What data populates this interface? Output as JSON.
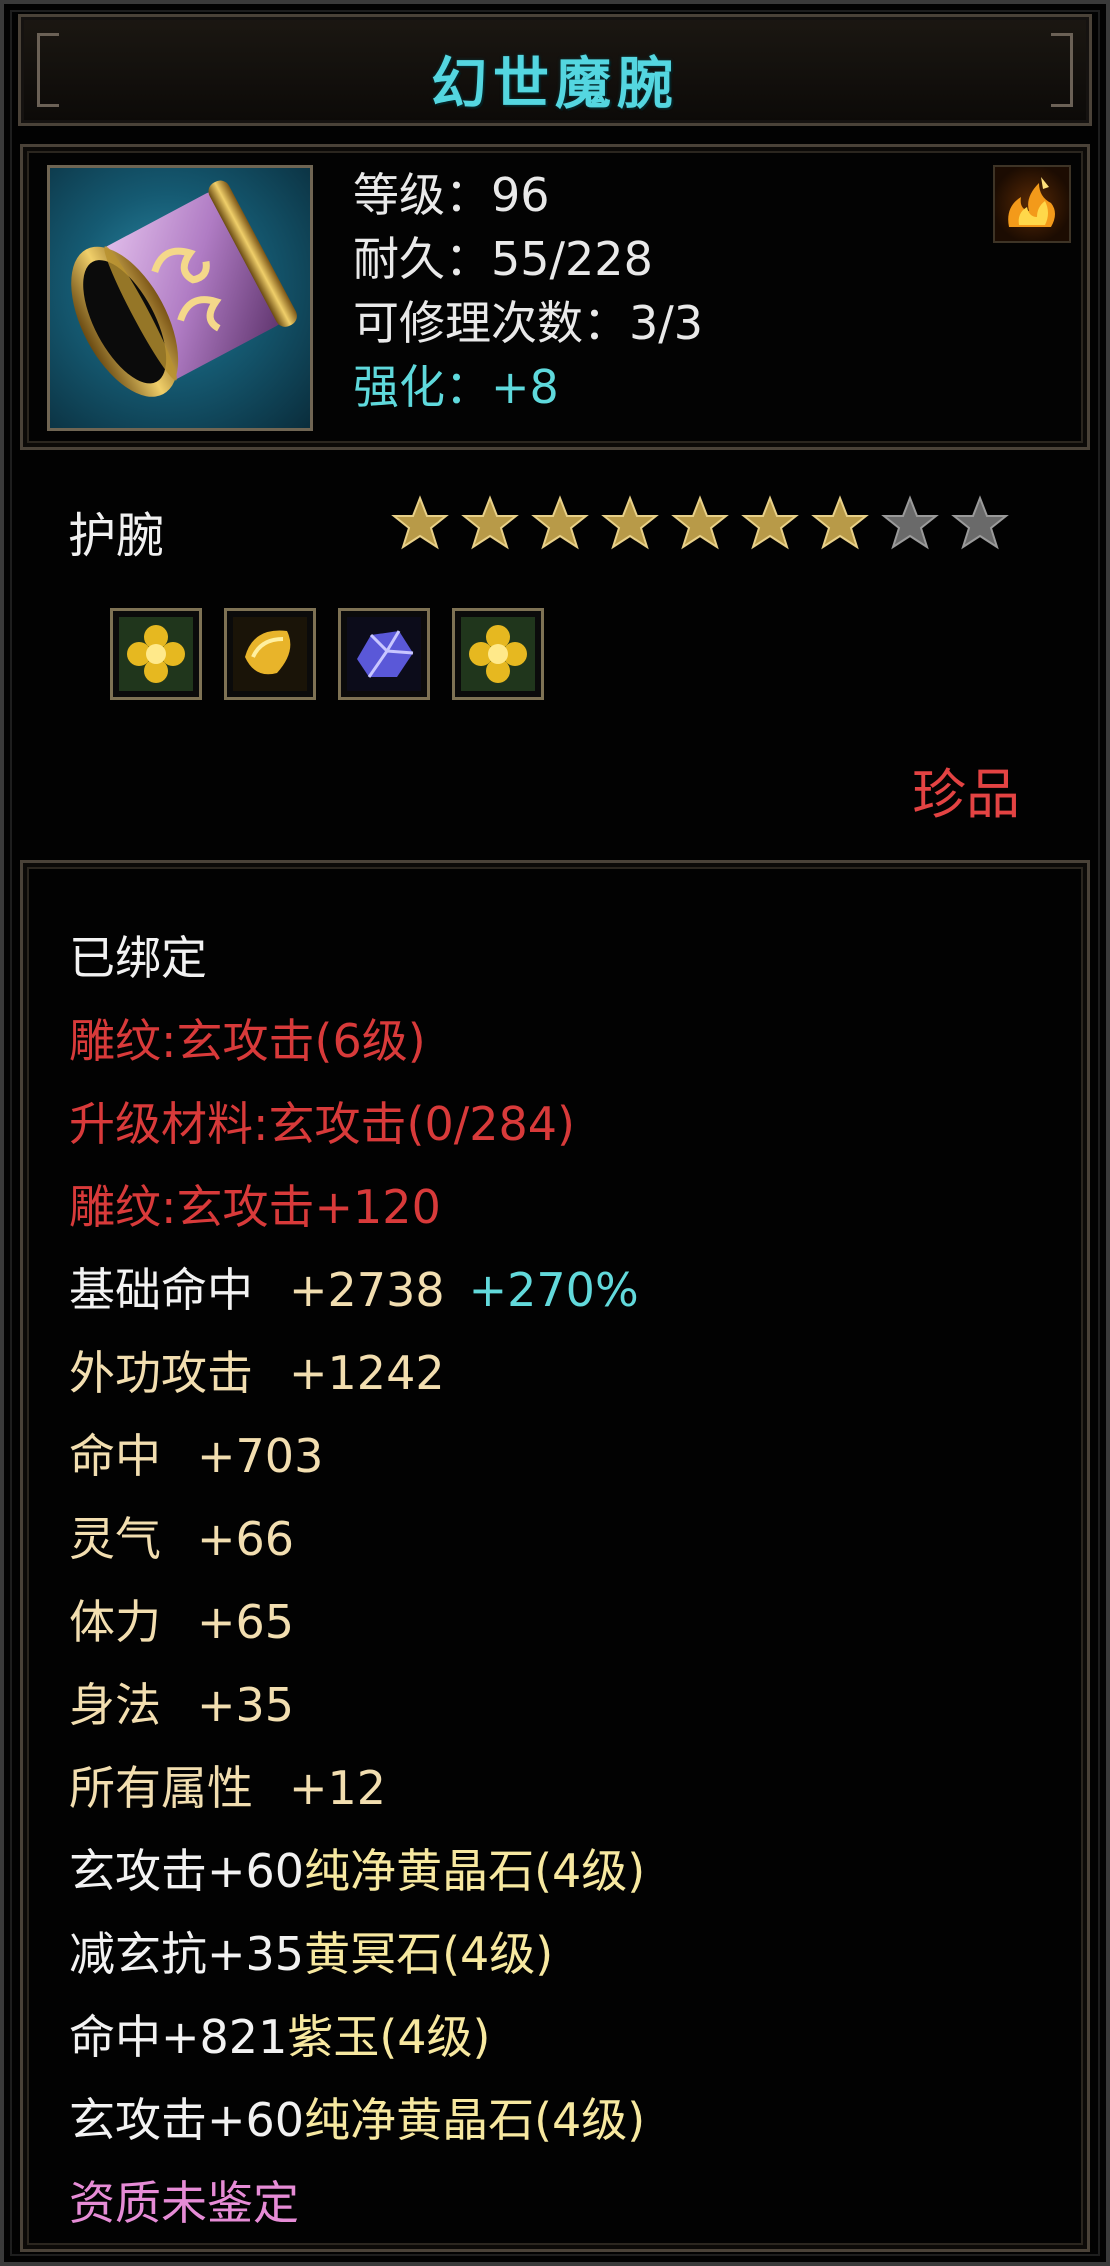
{
  "item": {
    "name": "幻世魔腕",
    "level": "等级：96",
    "durability": "耐久：55/228",
    "repair_count": "可修理次数：3/3",
    "enhance": "强化：+8",
    "type": "护腕",
    "stars_total": 9,
    "stars_filled": 7,
    "rarity": "珍品"
  },
  "gems": [
    {
      "icon": "yellow-flower-gem-icon"
    },
    {
      "icon": "gold-leaf-gem-icon"
    },
    {
      "icon": "purple-crystal-gem-icon"
    },
    {
      "icon": "yellow-flower-gem-icon"
    }
  ],
  "details": {
    "bound": "已绑定",
    "engrave_1": "雕纹:玄攻击(6级)",
    "upgrade_material": "升级材料:玄攻击(0/284)",
    "engrave_2": "雕纹:玄攻击+120",
    "base_hit_label": "基础命中",
    "base_hit_value": "+2738",
    "base_hit_percent": "+270%",
    "stats": [
      {
        "label": "外功攻击",
        "value": "+1242"
      },
      {
        "label": "命中",
        "value": "+703"
      },
      {
        "label": "灵气",
        "value": "+66"
      },
      {
        "label": "体力",
        "value": "+65"
      },
      {
        "label": "身法",
        "value": "+35"
      },
      {
        "label": "所有属性",
        "value": "+12"
      }
    ],
    "gem_lines": [
      {
        "effect": "玄攻击+60",
        "gem": "纯净黄晶石(4级)"
      },
      {
        "effect": "减玄抗+35",
        "gem": "黄冥石(4级)"
      },
      {
        "effect": "命中+821",
        "gem": "紫玉(4级)"
      },
      {
        "effect": "玄攻击+60",
        "gem": "纯净黄晶石(4级)"
      }
    ],
    "quality": "资质未鉴定"
  },
  "colors": {
    "title": "#54d6e0",
    "enhance": "#5fd9dc",
    "rarity": "#e34343",
    "engrave": "#d83a3a",
    "stat_label": "#f2deb0",
    "gem_name": "#f7e8a0",
    "quality": "#e68cd6",
    "star_filled": "#b89a48",
    "star_empty": "#6a6a6a"
  }
}
